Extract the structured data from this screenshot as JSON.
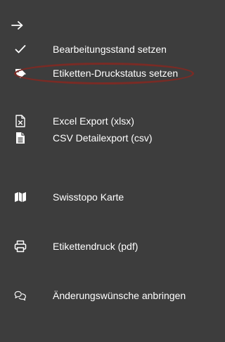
{
  "menu": {
    "items": [
      {
        "id": "bearbeitungsstand",
        "label": "Bearbeitungsstand setzen",
        "icon": "check-icon"
      },
      {
        "id": "etiketten-druckstatus",
        "label": "Etiketten-Druckstatus setzen",
        "icon": "tag-icon"
      },
      {
        "id": "excel-export",
        "label": "Excel Export (xlsx)",
        "icon": "excel-file-icon"
      },
      {
        "id": "csv-export",
        "label": "CSV Detailexport (csv)",
        "icon": "csv-file-icon"
      },
      {
        "id": "swisstopo",
        "label": "Swisstopo Karte",
        "icon": "map-icon"
      },
      {
        "id": "etikettendruck",
        "label": "Etikettendruck (pdf)",
        "icon": "printer-icon"
      },
      {
        "id": "aenderungswuensche",
        "label": "Änderungswünsche anbringen",
        "icon": "comments-icon"
      }
    ]
  },
  "colors": {
    "panel_background": "#3d3d3d",
    "text": "#ffffff",
    "highlight_ellipse": "#7a2b25"
  }
}
